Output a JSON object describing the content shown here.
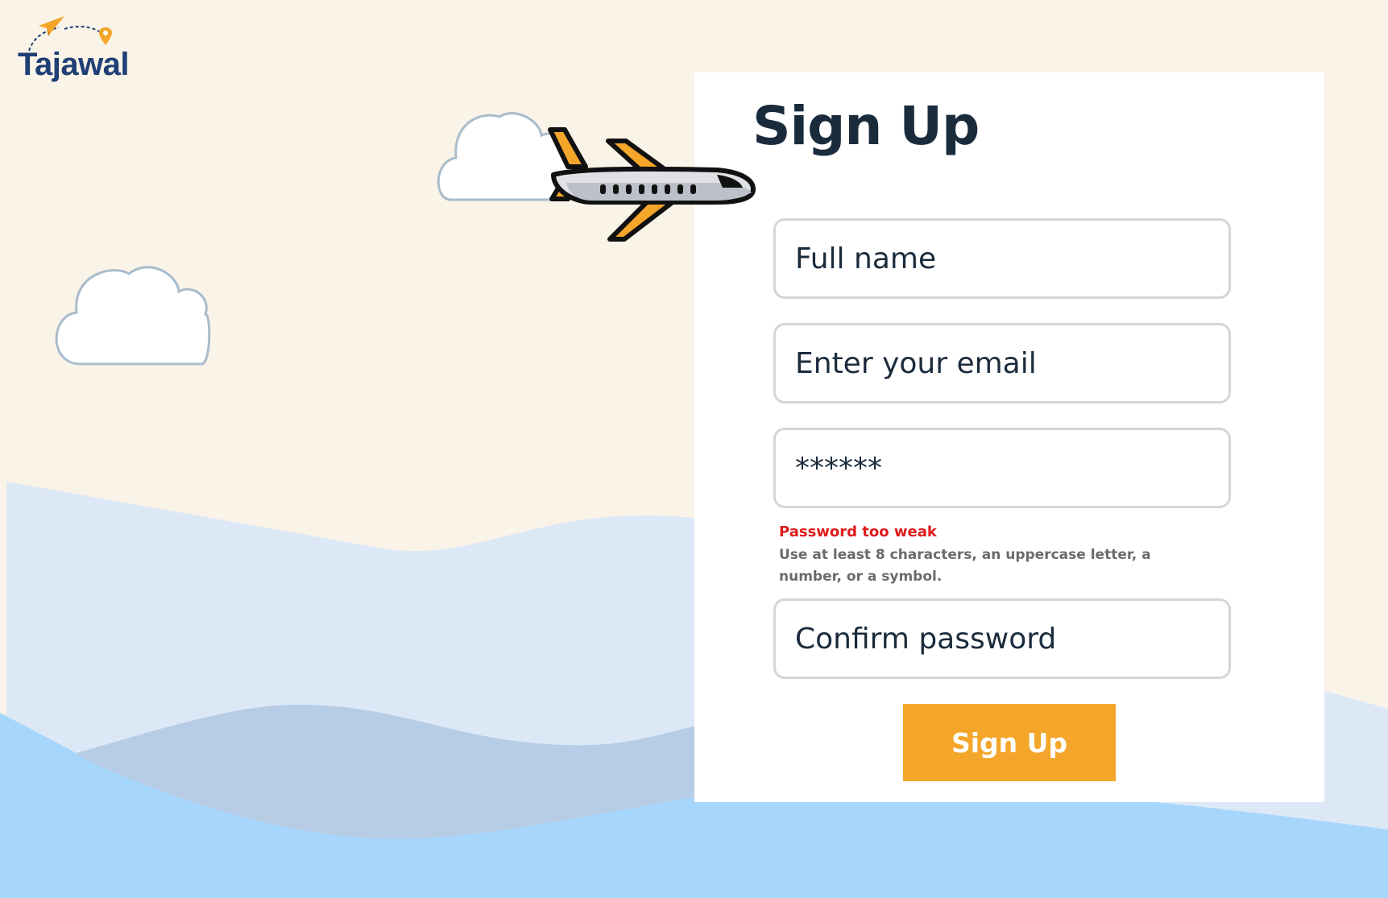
{
  "brand": {
    "name": "Tajawal"
  },
  "form": {
    "title": "Sign Up",
    "full_name_placeholder": "Full name",
    "email_placeholder": "Enter your email",
    "password_value": "******",
    "password_error_title": "Password too weak",
    "password_error_text": "Use at least 8 characters, an uppercase letter, a number, or a symbol.",
    "confirm_placeholder": "Confirm password",
    "submit_label": "Sign Up"
  },
  "colors": {
    "background": "#faf3e8",
    "accent": "#f4a62a",
    "error": "#e01b1b",
    "title": "#1a2b3c",
    "brand": "#1f3f75"
  },
  "icons": [
    "paper-plane-icon",
    "location-pin-icon",
    "airplane-icon",
    "cloud-icon"
  ]
}
